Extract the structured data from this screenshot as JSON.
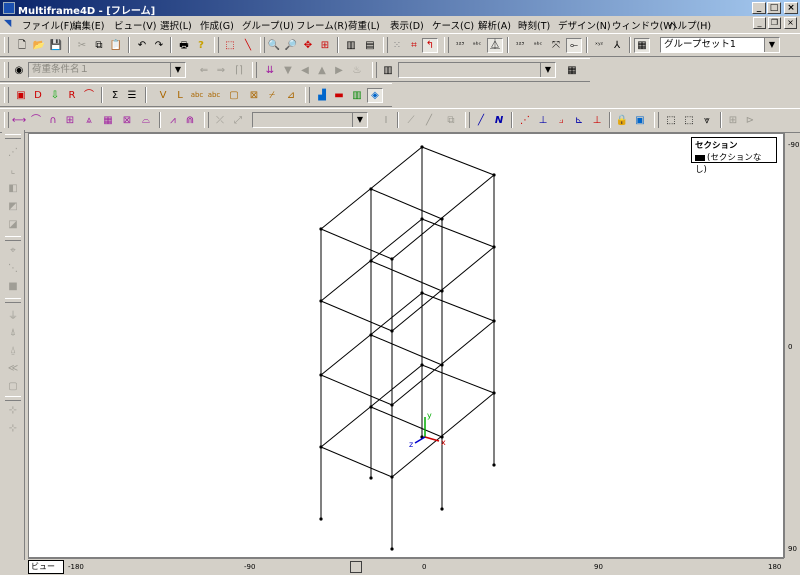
{
  "window": {
    "title": "Multiframe4D - [フレーム]"
  },
  "menu": [
    "ファイル(F)",
    "編集(E)",
    "ビュー(V)",
    "選択(L)",
    "作成(G)",
    "グループ(U)",
    "フレーム(R)",
    "荷重(L)",
    "表示(D)",
    "ケース(C)",
    "解析(A)",
    "時刻(T)",
    "デザイン(N)",
    "ウィンドウ(W)",
    "ヘルプ(H)"
  ],
  "toolbar": {
    "group_set": "グループセット1",
    "load_case_placeholder": "荷重条件名１"
  },
  "canvas": {
    "legend_title": "セクション",
    "legend_item": "(セクションなし)",
    "view_tab": "ビュー",
    "axis_x": "x",
    "axis_y": "y",
    "axis_z": "z"
  },
  "ruler_h": [
    "-180",
    "-90",
    "0",
    "90",
    "180"
  ],
  "ruler_v": [
    "-90",
    "0",
    "90"
  ],
  "colors": {
    "title_start": "#0a246a",
    "title_end": "#a6caf0",
    "axis_x": "#cc0000",
    "axis_y": "#00aa00",
    "axis_z": "#0000cc"
  }
}
